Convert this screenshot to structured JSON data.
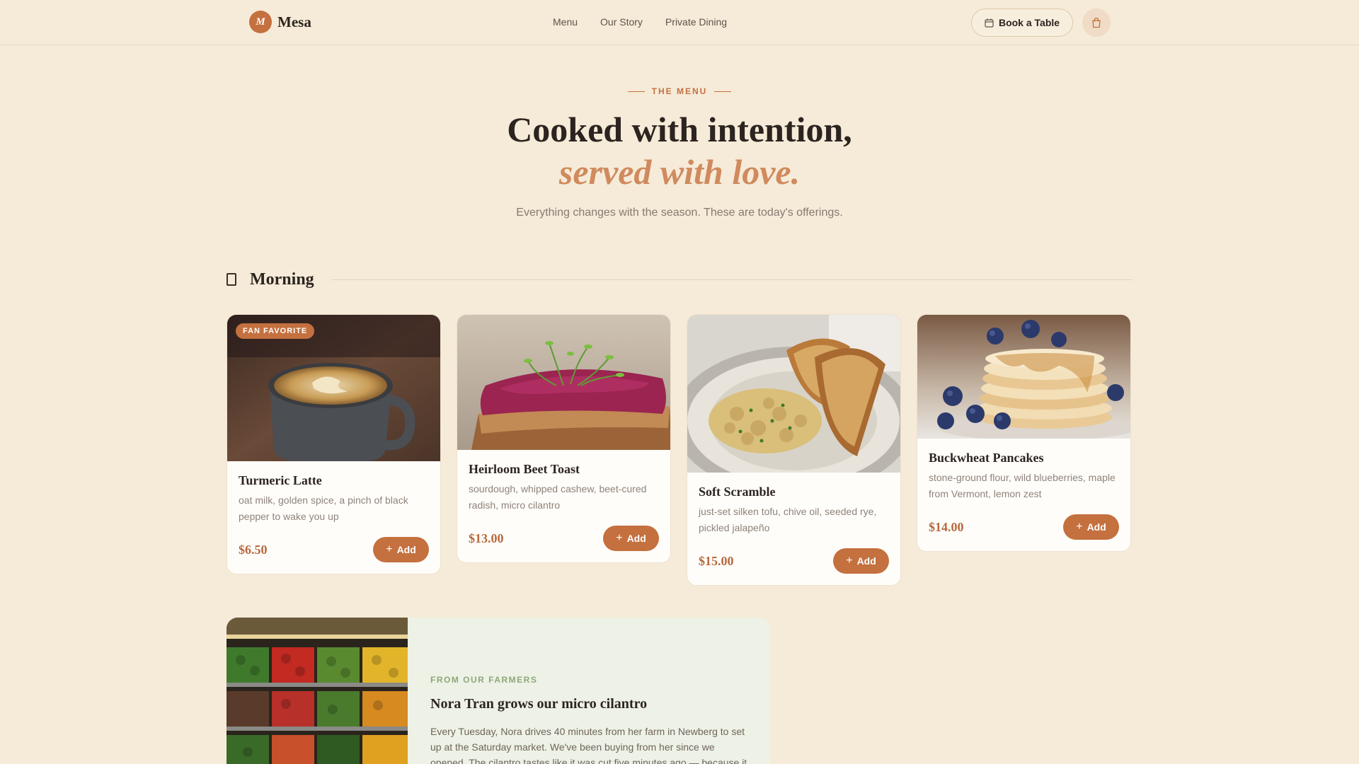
{
  "nav": {
    "brand_mark": "M",
    "brand_name": "Mesa",
    "links": [
      "Menu",
      "Our Story",
      "Private Dining"
    ],
    "book_label": "Book a Table"
  },
  "hero": {
    "eyebrow": "THE MENU",
    "title": "Cooked with intention,",
    "subtitle": "served with love.",
    "description": "Everything changes with the season. These are today's offerings."
  },
  "section": {
    "title": "Morning"
  },
  "cards": [
    {
      "badge": "FAN FAVORITE",
      "name": "Turmeric Latte",
      "description": "oat milk, golden spice, a pinch of black pepper to wake you up",
      "price": "$6.50",
      "add_label": "Add"
    },
    {
      "name": "Heirloom Beet Toast",
      "description": "sourdough, whipped cashew, beet-cured radish, micro cilantro",
      "price": "$13.00",
      "add_label": "Add"
    },
    {
      "name": "Soft Scramble",
      "description": "just-set silken tofu, chive oil, seeded rye, pickled jalapeño",
      "price": "$15.00",
      "add_label": "Add"
    },
    {
      "name": "Buckwheat Pancakes",
      "description": "stone-ground flour, wild blueberries, maple from Vermont, lemon zest",
      "price": "$14.00",
      "add_label": "Add"
    }
  ],
  "farmer": {
    "eyebrow": "FROM OUR FARMERS",
    "title": "Nora Tran grows our micro cilantro",
    "body": "Every Tuesday, Nora drives 40 minutes from her farm in Newberg to set up at the Saturday market. We've been buying from her since we opened. The cilantro tastes like it was cut five minutes ago — because it"
  },
  "colors": {
    "background": "#f6ebd8",
    "accent": "#c4703f",
    "accent_light": "#d08a5e",
    "farmer_bg": "#edf1e6",
    "farmer_accent": "#8fa778"
  }
}
